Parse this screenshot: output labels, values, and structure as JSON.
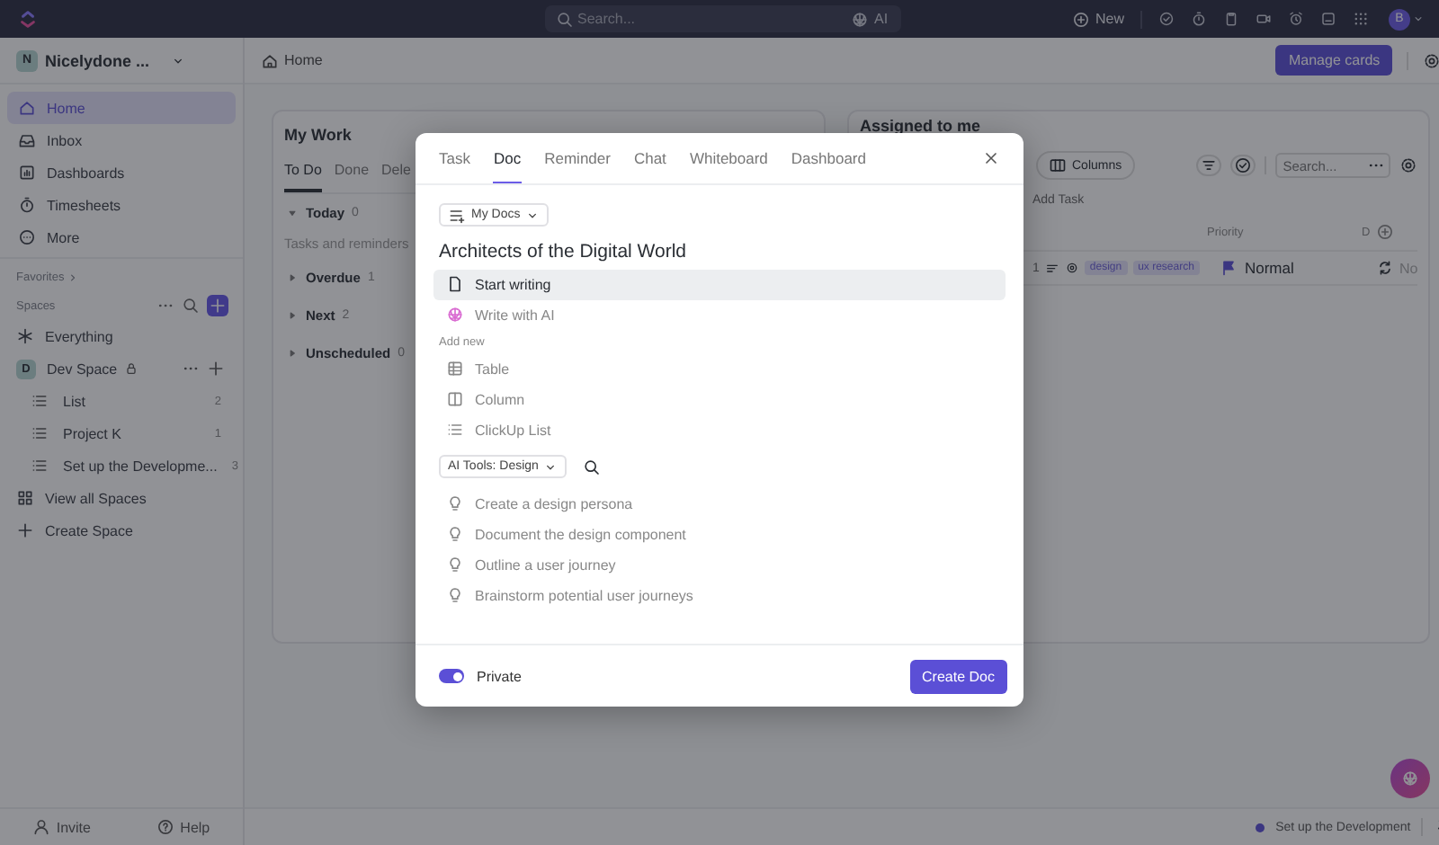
{
  "top_bar": {
    "search": {
      "placeholder": "Search..."
    },
    "ai_button": "AI",
    "new_button": "New",
    "avatar": "B"
  },
  "workspace": {
    "initial": "N",
    "name": "Nicelydone ..."
  },
  "breadcrumb": "Home",
  "manage_button": "Manage cards",
  "sidebar": {
    "items": [
      {
        "label": "Home",
        "selected": true
      },
      {
        "label": "Inbox",
        "selected": false
      },
      {
        "label": "Dashboards",
        "selected": false
      },
      {
        "label": "Timesheets",
        "selected": false
      },
      {
        "label": "More",
        "selected": false
      }
    ],
    "favorites": "Favorites",
    "spaces": {
      "label": "Spaces",
      "items": [
        {
          "kind": "everything",
          "label": "Everything"
        },
        {
          "kind": "space",
          "initial": "D",
          "label": "Dev Space",
          "locked": true,
          "children": [
            {
              "label": "List",
              "count": "2"
            },
            {
              "label": "Project K",
              "count": "1"
            },
            {
              "label": "Set up the Developme...",
              "count": "3"
            }
          ]
        },
        {
          "kind": "view_all",
          "label": "View all Spaces"
        },
        {
          "kind": "create",
          "label": "Create Space"
        }
      ]
    },
    "footer": [
      "Invite",
      "Help"
    ]
  },
  "my_work": {
    "title": "My Work",
    "tabs": [
      {
        "label": "To Do",
        "selected": true
      },
      {
        "label": "Done",
        "selected": false
      },
      {
        "label": "Dele",
        "selected": false
      }
    ],
    "groups": [
      {
        "label": "Today",
        "count": "0",
        "expanded": true,
        "hint": "Tasks and reminders"
      },
      {
        "label": "Overdue",
        "count": "1",
        "expanded": false
      },
      {
        "label": "Next",
        "count": "2",
        "expanded": false
      },
      {
        "label": "Unscheduled",
        "count": "0",
        "expanded": false
      }
    ]
  },
  "assigned": {
    "title": "Assigned to me",
    "columns_button": "Columns",
    "search": {
      "placeholder": "Search..."
    },
    "add_task": "Add Task",
    "columns": [
      "Priority",
      "D"
    ],
    "rows": [
      {
        "count": "1",
        "tags": [
          "design",
          "ux research"
        ],
        "priority": "Normal",
        "column_3": "No"
      }
    ]
  },
  "status_bar": {
    "task": "Set up the Development"
  },
  "doc_modal": {
    "tabs": [
      {
        "label": "Task",
        "selected": false
      },
      {
        "label": "Doc",
        "selected": true
      },
      {
        "label": "Reminder",
        "selected": false
      },
      {
        "label": "Chat",
        "selected": false
      },
      {
        "label": "Whiteboard",
        "selected": false
      },
      {
        "label": "Dashboard",
        "selected": false
      }
    ],
    "location": "My Docs",
    "title": "Architects of the Digital World",
    "start_options": [
      {
        "label": "Start writing",
        "selected": true
      },
      {
        "label": "Write with AI",
        "selected": false
      }
    ],
    "add_new": {
      "heading": "Add new",
      "items": [
        "Table",
        "Column",
        "ClickUp List"
      ]
    },
    "ai_tools": {
      "label": "AI Tools: Design",
      "suggestions": [
        "Create a design persona",
        "Document the design component",
        "Outline a user journey",
        "Brainstorm potential user journeys"
      ]
    },
    "private": {
      "label": "Private",
      "on": true
    },
    "create_button": "Create Doc"
  }
}
